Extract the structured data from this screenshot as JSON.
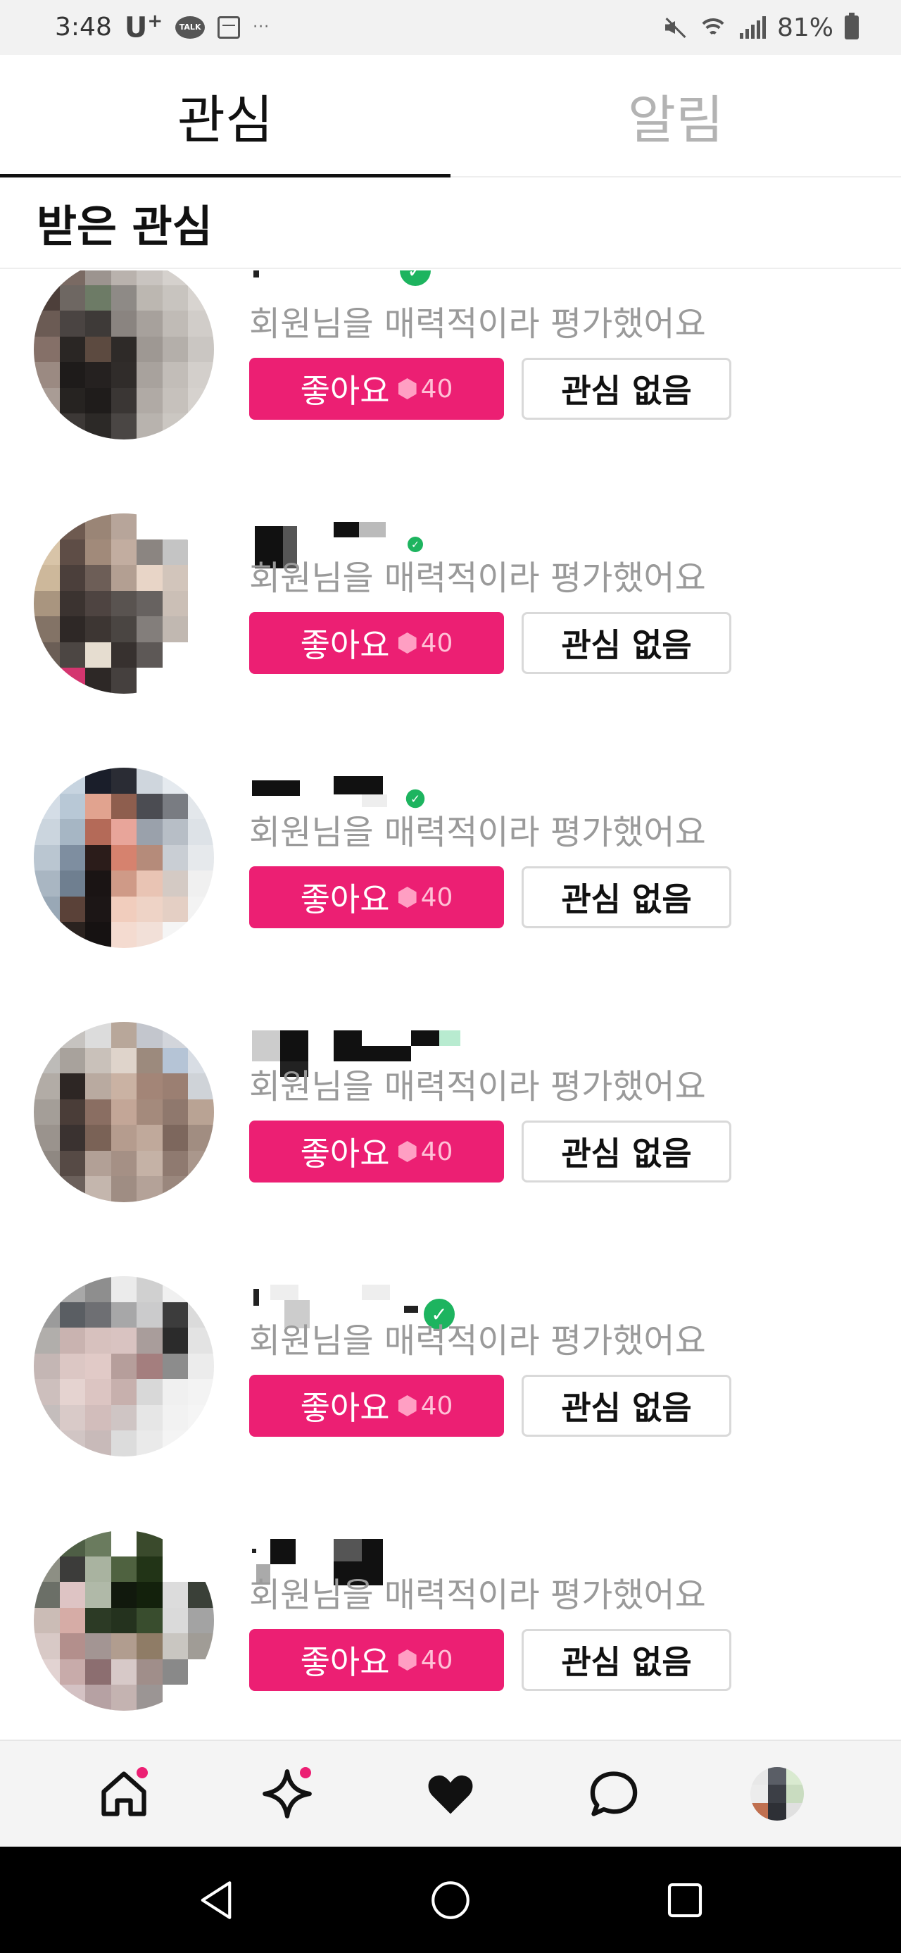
{
  "status_bar": {
    "time": "3:48",
    "carrier": "U",
    "carrier_sup": "+",
    "talk_badge": "TALK",
    "dots": "···",
    "battery": "81%"
  },
  "tabs": [
    {
      "label": "관심",
      "active": true
    },
    {
      "label": "알림",
      "active": false
    }
  ],
  "section": {
    "title": "받은 관심"
  },
  "items": [
    {
      "description": "회원님을 매력적이라 평가했어요",
      "like_label": "좋아요",
      "cost": "40",
      "pass_label": "관심 없음",
      "verified": true
    },
    {
      "description": "회원님을 매력적이라 평가했어요",
      "like_label": "좋아요",
      "cost": "40",
      "pass_label": "관심 없음",
      "verified": true
    },
    {
      "description": "회원님을 매력적이라 평가했어요",
      "like_label": "좋아요",
      "cost": "40",
      "pass_label": "관심 없음",
      "verified": true
    },
    {
      "description": "회원님을 매력적이라 평가했어요",
      "like_label": "좋아요",
      "cost": "40",
      "pass_label": "관심 없음",
      "verified": false
    },
    {
      "description": "회원님을 매력적이라 평가했어요",
      "like_label": "좋아요",
      "cost": "40",
      "pass_label": "관심 없음",
      "verified": true
    },
    {
      "description": "회원님을 매력적이라 평가했어요",
      "like_label": "좋아요",
      "cost": "40",
      "pass_label": "관심 없음",
      "verified": false
    }
  ],
  "bottom_nav": [
    {
      "icon": "home-icon",
      "badge": true
    },
    {
      "icon": "sparkle-icon",
      "badge": true
    },
    {
      "icon": "heart-icon",
      "badge": false
    },
    {
      "icon": "chat-icon",
      "badge": false
    },
    {
      "icon": "profile-avatar",
      "badge": false
    }
  ],
  "colors": {
    "accent": "#ec1f73",
    "verified": "#1db45f",
    "muted_text": "#9a9a9a"
  }
}
